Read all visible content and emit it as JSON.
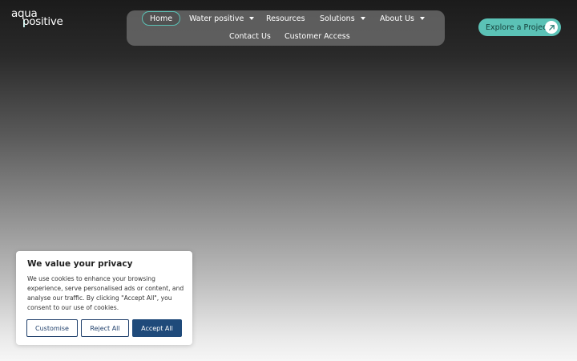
{
  "brand": {
    "line1": "aqua",
    "line2": "positive",
    "accent": "#5bc2b6"
  },
  "nav": {
    "items": [
      {
        "label": "Home",
        "active": true
      },
      {
        "label": "Water positive",
        "dropdown": true
      },
      {
        "label": "Resources"
      },
      {
        "label": "Solutions",
        "dropdown": true
      },
      {
        "label": "About Us",
        "dropdown": true
      },
      {
        "label": "Contact Us"
      },
      {
        "label": "Customer Access"
      }
    ]
  },
  "cta": {
    "label": "Explore a Project",
    "icon": "arrow-up-right-icon"
  },
  "cookie": {
    "title": "We value your privacy",
    "body": "We use cookies to enhance your browsing experience, serve personalised ads or content, and analyse our traffic. By clicking \"Accept All\", you consent to our use of cookies.",
    "buttons": {
      "customise": "Customise",
      "reject": "Reject All",
      "accept": "Accept All"
    },
    "colors": {
      "primary": "#1f4a7a"
    }
  }
}
